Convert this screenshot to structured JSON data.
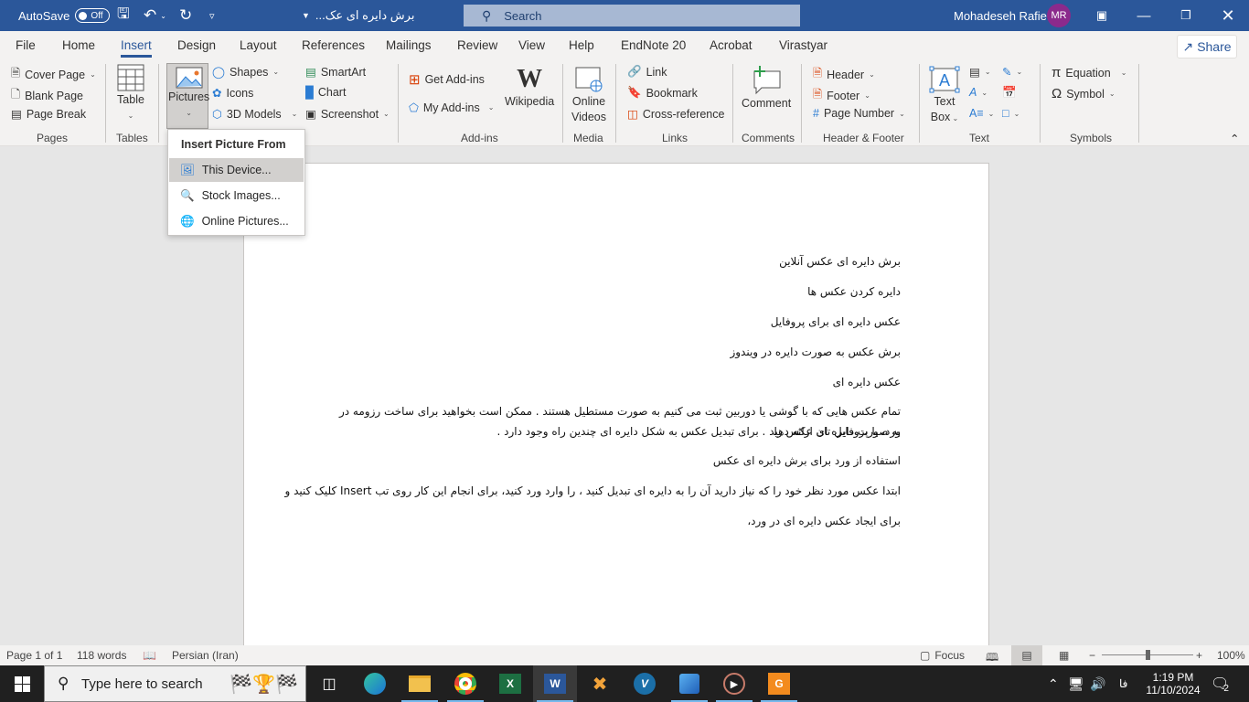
{
  "titlebar": {
    "autosave_label": "AutoSave",
    "autosave_state": "Off",
    "doc_title": "برش دایره ای عک...",
    "search_placeholder": "Search",
    "user_name": "Mohadeseh Rafie",
    "user_initials": "MR",
    "colors": {
      "bar": "#2b579a",
      "avatar": "#8b2a8c"
    }
  },
  "menu": {
    "tabs": [
      "File",
      "Home",
      "Insert",
      "Design",
      "Layout",
      "References",
      "Mailings",
      "Review",
      "View",
      "Help",
      "EndNote 20",
      "Acrobat",
      "Virastyar"
    ],
    "active_tab": "Insert",
    "share_label": "Share"
  },
  "ribbon": {
    "pages": {
      "label": "Pages",
      "items": [
        "Cover Page",
        "Blank Page",
        "Page Break"
      ]
    },
    "tables": {
      "label": "Tables",
      "table": "Table"
    },
    "illustrations": {
      "pictures": "Pictures",
      "shapes": "Shapes",
      "icons": "Icons",
      "models": "3D Models",
      "smartart": "SmartArt",
      "chart": "Chart",
      "screenshot": "Screenshot"
    },
    "addins": {
      "label": "Add-ins",
      "get": "Get Add-ins",
      "my": "My Add-ins",
      "wikipedia": "Wikipedia"
    },
    "media": {
      "label": "Media",
      "online_videos_1": "Online",
      "online_videos_2": "Videos"
    },
    "links": {
      "label": "Links",
      "link": "Link",
      "bookmark": "Bookmark",
      "crossref": "Cross-reference"
    },
    "comments": {
      "label": "Comments",
      "comment": "Comment"
    },
    "header_footer": {
      "label": "Header & Footer",
      "header": "Header",
      "footer": "Footer",
      "page_number": "Page Number"
    },
    "text": {
      "label": "Text",
      "textbox_1": "Text",
      "textbox_2": "Box"
    },
    "symbols": {
      "label": "Symbols",
      "equation": "Equation",
      "symbol": "Symbol"
    }
  },
  "picture_menu": {
    "title": "Insert Picture From",
    "items": [
      "This Device...",
      "Stock Images...",
      "Online Pictures..."
    ],
    "highlighted": "This Device..."
  },
  "document": {
    "paragraphs": [
      "برش دایره ای عکس آنلاین",
      "دایره کردن عکس ها",
      "عکس دایره ای برای پروفایل",
      "برش عکس به صورت دایره در ویندوز",
      "عکس دایره ای",
      "تمام عکس هایی که با گوشی یا دوربین ثبت می کنیم به صورت مستطیل هستند . ممکن است بخواهید برای ساخت رزومه در ورد، یا پروفایل تان عکس را",
      "به صورت دایره ای ارائه دهید . برای تبدیل عکس به شکل دایره ای چندین راه وجود دارد .",
      "استفاده از ورد برای برش دایره ای عکس",
      "ابتدا عکس مورد نظر خود را که نیاز دارید آن را به دایره ای تبدیل کنید ، را وارد ورد کنید، برای انجام این کار روی تب Insert کلیک کنید و",
      "برای ایجاد عکس دایره ای در ورد،"
    ]
  },
  "statusbar": {
    "page": "Page 1 of 1",
    "words": "118 words",
    "language": "Persian (Iran)",
    "focus": "Focus",
    "zoom": "100%",
    "zoom_percent": 100
  },
  "taskbar": {
    "search_placeholder": "Type here to search",
    "time": "1:19 PM",
    "date": "11/10/2024",
    "lang": "فا",
    "notifications": "2"
  }
}
